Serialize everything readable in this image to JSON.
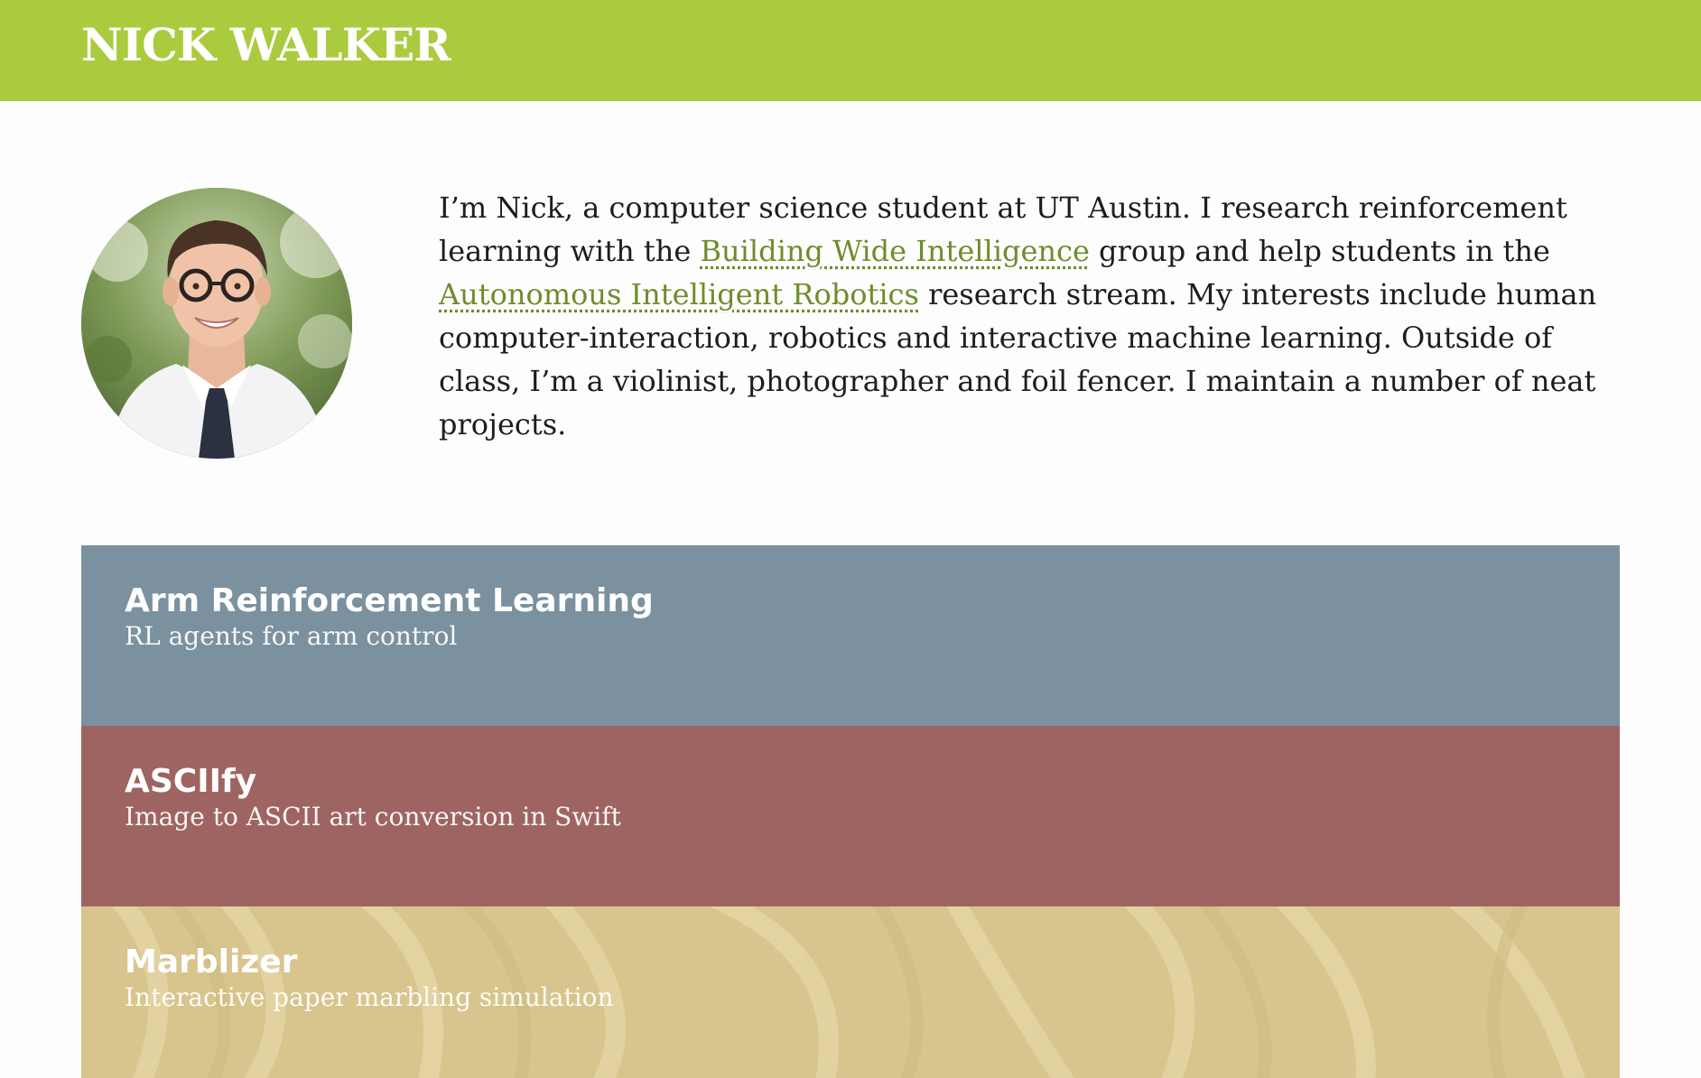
{
  "header": {
    "title": "NICK WALKER",
    "accent_color": "#aacb3d"
  },
  "profile": {
    "avatar_alt": "Portrait of Nick",
    "bio": {
      "part1": "I’m Nick, a computer science student at UT Austin. I research reinforcement learning with the ",
      "link1": "Building Wide Intelligence",
      "part2": " group and help students in the ",
      "link2": "Autonomous Intelligent Robotics",
      "part3": " research stream. My interests include human computer-interaction, robotics and interactive machine learning. Outside of class, I’m a violinist, photographer and foil fencer. I maintain a number of neat projects.",
      "link_color": "#6d8d2a"
    }
  },
  "projects": [
    {
      "title": "Arm Reinforcement Learning",
      "subtitle": "RL agents for arm control",
      "color": "#7b919f"
    },
    {
      "title": "ASCIIfy",
      "subtitle": "Image to ASCII art conversion in Swift",
      "color": "#9e6461"
    },
    {
      "title": "Marblizer",
      "subtitle": "Interactive paper marbling simulation",
      "color": "#d8c58e"
    }
  ]
}
